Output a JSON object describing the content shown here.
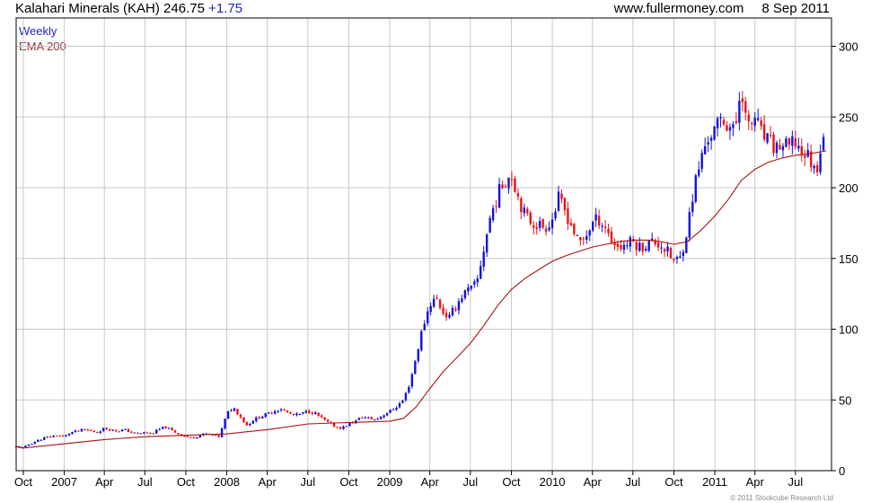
{
  "header": {
    "ticker": "Kalahari Minerals (KAH) 246.75",
    "change": "+1.75",
    "site": "www.fullermoney.com",
    "date": "8 Sep 2011"
  },
  "legend": {
    "weekly": "Weekly",
    "ema": "EMA 200"
  },
  "footer": "© 2011 Stockcube Research Ltd",
  "colors": {
    "up": "#1111dd",
    "down": "#ee1111",
    "ema": "#aa1111",
    "grid": "#c8c8c8",
    "axis": "#000000"
  },
  "chart_data": {
    "type": "candlestick",
    "ylim": [
      0,
      320
    ],
    "ytick_values": [
      0,
      50,
      100,
      150,
      200,
      250,
      300
    ],
    "xtick_labels": [
      "Oct",
      "2007",
      "Apr",
      "Jul",
      "Oct",
      "2008",
      "Apr",
      "Jul",
      "Oct",
      "2009",
      "Apr",
      "Jul",
      "Oct",
      "2010",
      "Apr",
      "Jul",
      "Oct",
      "2011",
      "Apr",
      "Jul"
    ],
    "xtick_dates": [
      "2006-10-01",
      "2007-01-01",
      "2007-04-01",
      "2007-07-01",
      "2007-10-01",
      "2008-01-01",
      "2008-04-01",
      "2008-07-01",
      "2008-10-01",
      "2009-01-01",
      "2009-04-01",
      "2009-07-01",
      "2009-10-01",
      "2010-01-01",
      "2010-04-01",
      "2010-07-01",
      "2010-10-01",
      "2011-01-01",
      "2011-04-01",
      "2011-07-01"
    ],
    "x_range": [
      "2006-09-15",
      "2011-09-20"
    ],
    "close_series": [
      [
        "2006-09-15",
        17
      ],
      [
        "2006-10-01",
        16
      ],
      [
        "2006-10-15",
        19
      ],
      [
        "2006-11-01",
        21
      ],
      [
        "2006-11-15",
        23
      ],
      [
        "2006-12-01",
        24
      ],
      [
        "2006-12-15",
        25
      ],
      [
        "2007-01-01",
        24
      ],
      [
        "2007-01-15",
        27
      ],
      [
        "2007-02-01",
        28
      ],
      [
        "2007-02-15",
        29
      ],
      [
        "2007-03-01",
        28
      ],
      [
        "2007-03-15",
        27
      ],
      [
        "2007-04-01",
        30
      ],
      [
        "2007-04-15",
        29
      ],
      [
        "2007-05-01",
        28
      ],
      [
        "2007-05-15",
        29
      ],
      [
        "2007-06-01",
        27
      ],
      [
        "2007-06-15",
        26
      ],
      [
        "2007-07-01",
        27
      ],
      [
        "2007-07-15",
        26
      ],
      [
        "2007-08-01",
        29
      ],
      [
        "2007-08-15",
        31
      ],
      [
        "2007-09-01",
        28
      ],
      [
        "2007-09-15",
        26
      ],
      [
        "2007-10-01",
        24
      ],
      [
        "2007-10-15",
        23
      ],
      [
        "2007-11-01",
        25
      ],
      [
        "2007-11-15",
        26
      ],
      [
        "2007-12-01",
        25
      ],
      [
        "2007-12-15",
        24
      ],
      [
        "2008-01-01",
        40
      ],
      [
        "2008-01-15",
        45
      ],
      [
        "2008-02-01",
        38
      ],
      [
        "2008-02-15",
        32
      ],
      [
        "2008-03-01",
        36
      ],
      [
        "2008-03-15",
        38
      ],
      [
        "2008-04-01",
        40
      ],
      [
        "2008-04-15",
        42
      ],
      [
        "2008-05-01",
        44
      ],
      [
        "2008-05-15",
        41
      ],
      [
        "2008-06-01",
        39
      ],
      [
        "2008-06-15",
        40
      ],
      [
        "2008-07-01",
        42
      ],
      [
        "2008-07-15",
        41
      ],
      [
        "2008-08-01",
        37
      ],
      [
        "2008-08-15",
        34
      ],
      [
        "2008-09-01",
        31
      ],
      [
        "2008-09-15",
        30
      ],
      [
        "2008-10-01",
        33
      ],
      [
        "2008-10-15",
        35
      ],
      [
        "2008-11-01",
        38
      ],
      [
        "2008-11-15",
        37
      ],
      [
        "2008-12-01",
        36
      ],
      [
        "2008-12-15",
        39
      ],
      [
        "2009-01-01",
        42
      ],
      [
        "2009-01-15",
        45
      ],
      [
        "2009-02-01",
        50
      ],
      [
        "2009-02-15",
        62
      ],
      [
        "2009-03-01",
        80
      ],
      [
        "2009-03-15",
        100
      ],
      [
        "2009-04-01",
        118
      ],
      [
        "2009-04-15",
        122
      ],
      [
        "2009-05-01",
        112
      ],
      [
        "2009-05-15",
        108
      ],
      [
        "2009-06-01",
        118
      ],
      [
        "2009-06-15",
        125
      ],
      [
        "2009-07-01",
        128
      ],
      [
        "2009-07-15",
        132
      ],
      [
        "2009-08-01",
        158
      ],
      [
        "2009-08-15",
        180
      ],
      [
        "2009-09-01",
        195
      ],
      [
        "2009-09-15",
        205
      ],
      [
        "2009-10-01",
        210
      ],
      [
        "2009-10-15",
        195
      ],
      [
        "2009-11-01",
        180
      ],
      [
        "2009-11-15",
        176
      ],
      [
        "2009-12-01",
        174
      ],
      [
        "2009-12-15",
        172
      ],
      [
        "2010-01-01",
        178
      ],
      [
        "2010-01-15",
        192
      ],
      [
        "2010-02-01",
        182
      ],
      [
        "2010-02-15",
        172
      ],
      [
        "2010-03-01",
        160
      ],
      [
        "2010-03-15",
        165
      ],
      [
        "2010-04-01",
        175
      ],
      [
        "2010-04-15",
        178
      ],
      [
        "2010-05-01",
        172
      ],
      [
        "2010-05-15",
        162
      ],
      [
        "2010-06-01",
        158
      ],
      [
        "2010-06-15",
        160
      ],
      [
        "2010-07-01",
        162
      ],
      [
        "2010-07-15",
        158
      ],
      [
        "2010-08-01",
        160
      ],
      [
        "2010-08-15",
        162
      ],
      [
        "2010-09-01",
        160
      ],
      [
        "2010-09-15",
        155
      ],
      [
        "2010-10-01",
        148
      ],
      [
        "2010-10-15",
        150
      ],
      [
        "2010-11-01",
        172
      ],
      [
        "2010-11-15",
        200
      ],
      [
        "2010-12-01",
        220
      ],
      [
        "2010-12-15",
        235
      ],
      [
        "2011-01-01",
        240
      ],
      [
        "2011-01-15",
        248
      ],
      [
        "2011-02-01",
        245
      ],
      [
        "2011-02-15",
        238
      ],
      [
        "2011-03-01",
        275
      ],
      [
        "2011-03-15",
        240
      ],
      [
        "2011-04-01",
        250
      ],
      [
        "2011-04-15",
        238
      ],
      [
        "2011-05-01",
        232
      ],
      [
        "2011-05-15",
        228
      ],
      [
        "2011-06-01",
        230
      ],
      [
        "2011-06-15",
        228
      ],
      [
        "2011-07-01",
        232
      ],
      [
        "2011-07-15",
        225
      ],
      [
        "2011-08-01",
        222
      ],
      [
        "2011-08-15",
        210
      ],
      [
        "2011-09-01",
        238
      ],
      [
        "2011-09-08",
        246.75
      ]
    ],
    "ema_series": [
      [
        "2006-09-15",
        17
      ],
      [
        "2006-10-01",
        16
      ],
      [
        "2006-11-01",
        17
      ],
      [
        "2007-01-01",
        19
      ],
      [
        "2007-04-01",
        22
      ],
      [
        "2007-07-01",
        24
      ],
      [
        "2007-10-01",
        25
      ],
      [
        "2008-01-01",
        26
      ],
      [
        "2008-04-01",
        29
      ],
      [
        "2008-07-01",
        33
      ],
      [
        "2008-10-01",
        34
      ],
      [
        "2009-01-01",
        35
      ],
      [
        "2009-02-01",
        37
      ],
      [
        "2009-03-01",
        45
      ],
      [
        "2009-04-01",
        58
      ],
      [
        "2009-05-01",
        70
      ],
      [
        "2009-06-01",
        80
      ],
      [
        "2009-07-01",
        90
      ],
      [
        "2009-08-01",
        103
      ],
      [
        "2009-09-01",
        117
      ],
      [
        "2009-10-01",
        128
      ],
      [
        "2009-11-01",
        136
      ],
      [
        "2009-12-01",
        142
      ],
      [
        "2010-01-01",
        148
      ],
      [
        "2010-02-01",
        152
      ],
      [
        "2010-03-01",
        155
      ],
      [
        "2010-04-01",
        158
      ],
      [
        "2010-05-01",
        160
      ],
      [
        "2010-06-01",
        162
      ],
      [
        "2010-07-01",
        163
      ],
      [
        "2010-08-01",
        163
      ],
      [
        "2010-09-01",
        162
      ],
      [
        "2010-10-01",
        160
      ],
      [
        "2010-11-01",
        162
      ],
      [
        "2010-12-01",
        170
      ],
      [
        "2011-01-01",
        180
      ],
      [
        "2011-02-01",
        192
      ],
      [
        "2011-03-01",
        205
      ],
      [
        "2011-04-01",
        213
      ],
      [
        "2011-05-01",
        218
      ],
      [
        "2011-06-01",
        221
      ],
      [
        "2011-07-01",
        223
      ],
      [
        "2011-08-01",
        224
      ],
      [
        "2011-09-08",
        226
      ]
    ]
  }
}
